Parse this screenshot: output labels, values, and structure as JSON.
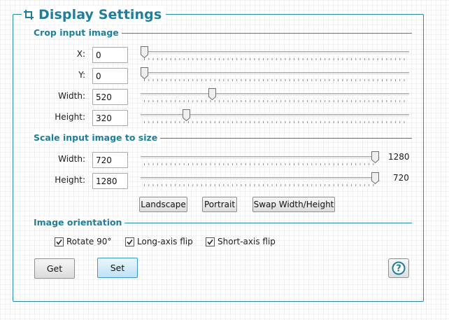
{
  "panel": {
    "title": "Display Settings",
    "title_icon": "crop-icon"
  },
  "crop": {
    "title": "Crop input image",
    "fields": [
      {
        "label": "X:",
        "value": "0",
        "slider_fraction": 0.0
      },
      {
        "label": "Y:",
        "value": "0",
        "slider_fraction": 0.0
      },
      {
        "label": "Width:",
        "value": "520",
        "slider_fraction": 0.26
      },
      {
        "label": "Height:",
        "value": "320",
        "slider_fraction": 0.16
      }
    ]
  },
  "scale": {
    "title": "Scale input image to size",
    "fields": [
      {
        "label": "Width:",
        "value": "720",
        "slider_fraction": 1.0,
        "max_label": "1280"
      },
      {
        "label": "Height:",
        "value": "1280",
        "slider_fraction": 1.0,
        "max_label": "720"
      }
    ],
    "buttons": {
      "landscape": "Landscape",
      "portrait": "Portrait",
      "swap": "Swap Width/Height"
    }
  },
  "orientation": {
    "title": "Image orientation",
    "options": [
      {
        "label": "Rotate 90°",
        "checked": true
      },
      {
        "label": "Long-axis flip",
        "checked": true
      },
      {
        "label": "Short-axis flip",
        "checked": true
      }
    ]
  },
  "actions": {
    "get": "Get",
    "set": "Set",
    "help_icon": "help-icon"
  },
  "colors": {
    "accent": "#1d7f9c",
    "primary_button": "#bfe1f5"
  }
}
